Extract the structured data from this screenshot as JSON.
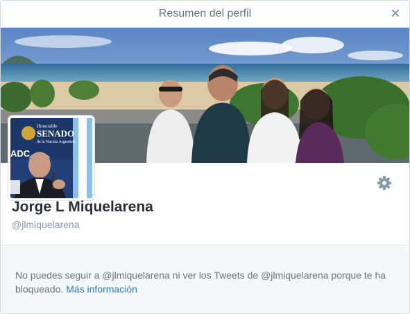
{
  "modal": {
    "title": "Resumen del perfil",
    "close_icon": "close-icon"
  },
  "profile": {
    "display_name": "Jorge L Miquelarena",
    "screen_name": "@jlmiquelarena",
    "banner_image": "beach-group-photo",
    "avatar_image": "senate-speaker-photo",
    "avatar_sign_lines": [
      "Honorable",
      "SENADO",
      "de la Nación Argentina"
    ],
    "avatar_sign_left": "ADC",
    "settings_icon": "gear-icon"
  },
  "notice": {
    "message": "No puedes seguir a @jlmiquelarena ni ver los Tweets de @jlmiquelarena porque te ha bloqueado.",
    "link_label": "Más información"
  },
  "colors": {
    "link": "#2b7bb9",
    "text_muted": "#66757f",
    "notice_bg": "#f5f8fa"
  }
}
